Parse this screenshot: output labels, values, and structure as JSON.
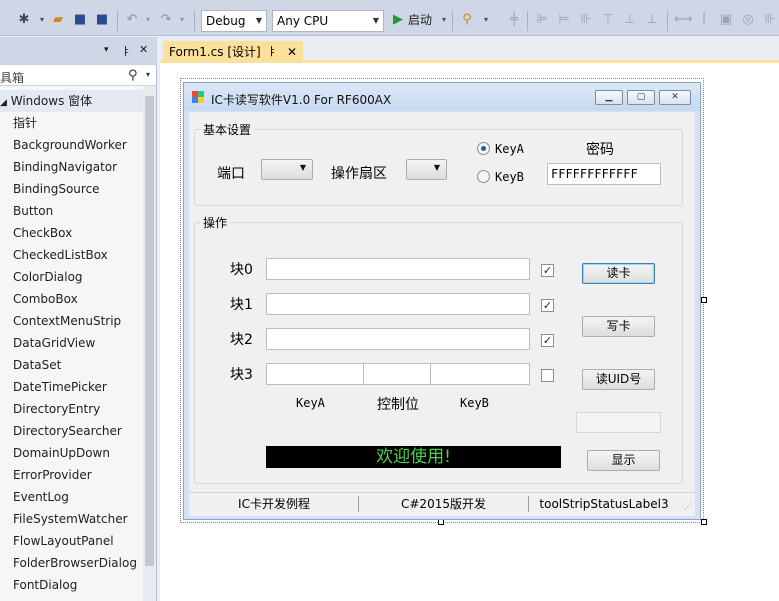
{
  "toolbar": {
    "config": "Debug",
    "platform": "Any CPU",
    "start_label": "启动"
  },
  "toolbox": {
    "header_pin": "ㅑ",
    "header_close": "✕",
    "header_menu": "▾",
    "search_placeholder": "具箱",
    "group": "Windows 窗体",
    "items": [
      "指针",
      "BackgroundWorker",
      "BindingNavigator",
      "BindingSource",
      "Button",
      "CheckBox",
      "CheckedListBox",
      "ColorDialog",
      "ComboBox",
      "ContextMenuStrip",
      "DataGridView",
      "DataSet",
      "DateTimePicker",
      "DirectoryEntry",
      "DirectorySearcher",
      "DomainUpDown",
      "ErrorProvider",
      "EventLog",
      "FileSystemWatcher",
      "FlowLayoutPanel",
      "FolderBrowserDialog",
      "FontDialog"
    ]
  },
  "editor": {
    "tab_label": "Form1.cs [设计]",
    "tab_pin": "ㅑ",
    "tab_close": "✕"
  },
  "form": {
    "title": "IC卡读写软件V1.0 For RF600AX",
    "basic": {
      "title": "基本设置",
      "port_label": "端口",
      "sector_label": "操作扇区",
      "keya_label": "KeyA",
      "keyb_label": "KeyB",
      "password_label": "密码",
      "password_value": "FFFFFFFFFFFF"
    },
    "ops": {
      "title": "操作",
      "blocks": [
        "块0",
        "块1",
        "块2",
        "块3"
      ],
      "checks": [
        true,
        true,
        true,
        false
      ],
      "sub_labels": {
        "keya": "KeyA",
        "control": "控制位",
        "keyb": "KeyB"
      },
      "read_button": "读卡",
      "write_button": "写卡",
      "uid_button": "读UID号",
      "show_button": "显示",
      "welcome": "欢迎使用!"
    },
    "status": [
      "IC卡开发例程",
      "C#2015版开发",
      "toolStripStatusLabel3"
    ]
  },
  "colors": {
    "tab_active": "#fbe09a",
    "welcome_fg": "#4cd14c",
    "welcome_bg": "#000000"
  }
}
